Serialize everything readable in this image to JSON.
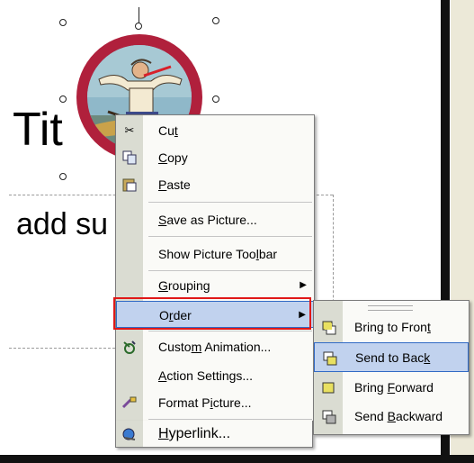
{
  "slide": {
    "title_text": "Tit",
    "subtitle_text": "add su"
  },
  "context_menu": {
    "items": [
      {
        "label_pre": "Cu",
        "label_key": "t",
        "label_post": "",
        "icon": "scissors-icon"
      },
      {
        "label_pre": "",
        "label_key": "C",
        "label_post": "opy",
        "icon": "copy-icon"
      },
      {
        "label_pre": "",
        "label_key": "P",
        "label_post": "aste",
        "icon": "paste-icon"
      },
      {
        "label_pre": "",
        "label_key": "S",
        "label_post": "ave as Picture...",
        "icon": ""
      },
      {
        "label_pre": "Show Picture Too",
        "label_key": "l",
        "label_post": "bar",
        "icon": ""
      },
      {
        "label_pre": "",
        "label_key": "G",
        "label_post": "rouping",
        "icon": "",
        "submenu": true
      },
      {
        "label_pre": "O",
        "label_key": "r",
        "label_post": "der",
        "icon": "",
        "submenu": true,
        "highlighted": true
      },
      {
        "label_pre": "Custo",
        "label_key": "m",
        "label_post": " Animation...",
        "icon": "animation-icon"
      },
      {
        "label_pre": "",
        "label_key": "A",
        "label_post": "ction Settings...",
        "icon": ""
      },
      {
        "label_pre": "Format P",
        "label_key": "i",
        "label_post": "cture...",
        "icon": "format-picture-icon"
      },
      {
        "label_pre": "",
        "label_key": "H",
        "label_post": "yperlink...",
        "icon": "hyperlink-icon"
      }
    ]
  },
  "order_submenu": {
    "items": [
      {
        "label_pre": "Bring to Fron",
        "label_key": "t",
        "label_post": "",
        "icon": "bring-to-front-icon"
      },
      {
        "label_pre": "Send to Bac",
        "label_key": "k",
        "label_post": "",
        "icon": "send-to-back-icon",
        "highlighted": true
      },
      {
        "label_pre": "Bring ",
        "label_key": "F",
        "label_post": "orward",
        "icon": "bring-forward-icon"
      },
      {
        "label_pre": "Send ",
        "label_key": "B",
        "label_post": "ackward",
        "icon": "send-backward-icon"
      }
    ]
  },
  "colors": {
    "menu_highlight": "#c1d2ee",
    "menu_highlight_border": "#316ac5",
    "annotation_box": "#e01818",
    "picture_ring": "#b0203c"
  }
}
